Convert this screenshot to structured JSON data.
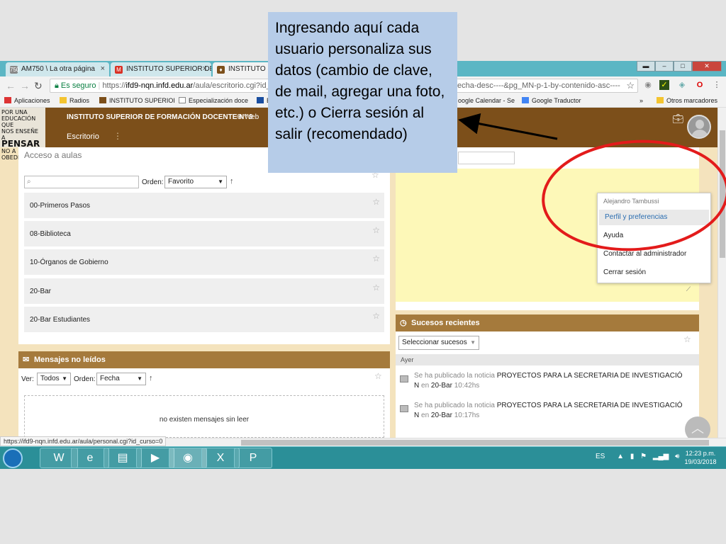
{
  "callout": {
    "text": "Ingresando aquí cada usuario personaliza sus datos (cambio de clave, de mail, agregar una foto, etc.) o Cierra sesión al salir (recomendado)"
  },
  "browser": {
    "tabs": [
      {
        "favicon": "750",
        "title": "AM750 \\ La otra página"
      },
      {
        "favicon": "M",
        "title": "INSTITUTO SUPERIOR DE"
      },
      {
        "favicon": "♦",
        "title": "INSTITUTO SU"
      }
    ],
    "address": {
      "secure_label": "Es seguro",
      "url_scheme": "https://",
      "url_host": "ifd9-nqn.infd.edu.ar",
      "url_path": "/aula/escritorio.cgi?id_c",
      "url_tail": "echa-desc----&pg_MN-p-1-by-contenido-asc----"
    },
    "bookmarks": [
      {
        "label": "Aplicaciones",
        "icon": "apps-grid-icon"
      },
      {
        "label": "Radios",
        "icon": "folder-icon"
      },
      {
        "label": "INSTITUTO SUPERIOI",
        "icon": "moodle-icon"
      },
      {
        "label": "Especialización doce",
        "icon": "page-icon"
      },
      {
        "label": "BP",
        "icon": "bp-icon"
      },
      {
        "label": "oogle Calendar - Se",
        "icon": "calendar-icon"
      },
      {
        "label": "Google Traductor",
        "icon": "translate-icon"
      },
      {
        "label": "»",
        "icon": "more-icon"
      },
      {
        "label": "Otros marcadores",
        "icon": "folder-icon"
      }
    ],
    "status_url": "https://ifd9-nqn.infd.edu.ar/aula/personal.cgi?id_curso=0"
  },
  "site": {
    "logo_lines": [
      "POR UNA",
      "EDUCACIÓN QUE",
      "NOS ENSEÑE A",
      "PENSAR",
      "NO A",
      "OBEDECER"
    ],
    "name": "INSTITUTO SUPERIOR DE FORMACIÓN DOCENTE N° 9",
    "web_label": "Web",
    "nav_escritorio": "Escritorio",
    "nav_more": "⋮"
  },
  "aulas": {
    "title": "Acceso a aulas",
    "order_label": "Orden:",
    "order_value": "Favorito",
    "courses": [
      "00-Primeros Pasos",
      "08-Biblioteca",
      "10-Órganos de Gobierno",
      "20-Bar",
      "20-Bar Estudiantes"
    ]
  },
  "mensajes": {
    "title": "Mensajes no leídos",
    "ver_label": "Ver:",
    "ver_value": "Todos",
    "order_label": "Orden:",
    "order_value": "Fecha",
    "empty_text": "no existen mensajes sin leer"
  },
  "sucesos": {
    "title": "Sucesos recientes",
    "select_value": "Seleccionar sucesos",
    "day": "Ayer",
    "events": [
      {
        "prefix": "Se ha publicado la noticia",
        "title": "PROYECTOS PARA LA SECRETARIA DE INVESTIGACIÓ",
        "title2": "N",
        "en": "en",
        "where": "20-Bar",
        "time": "10:42hs"
      },
      {
        "prefix": "Se ha publicado la noticia",
        "title": "PROYECTOS PARA LA SECRETARIA DE INVESTIGACIÓ",
        "title2": "N",
        "en": "en",
        "where": "20-Bar",
        "time": "10:17hs"
      }
    ]
  },
  "user_menu": {
    "user_name": "Alejandro Tambussi",
    "items": [
      "Perfil y preferencias",
      "Ayuda",
      "Contactar al administrador",
      "Cerrar sesión"
    ]
  },
  "taskbar": {
    "apps": [
      {
        "icon": "word-icon",
        "glyph": "W"
      },
      {
        "icon": "ie-icon",
        "glyph": "e"
      },
      {
        "icon": "explorer-icon",
        "glyph": "▤"
      },
      {
        "icon": "media-player-icon",
        "glyph": "▶"
      },
      {
        "icon": "chrome-icon",
        "glyph": "◉"
      },
      {
        "icon": "excel-icon",
        "glyph": "X"
      },
      {
        "icon": "powerpoint-icon",
        "glyph": "P"
      }
    ],
    "lang": "ES",
    "time": "12:23 p.m.",
    "date": "19/03/2018"
  },
  "colors": {
    "header_brown": "#7c4f1a",
    "block_header": "#a57a3c",
    "callout_bg": "#b6cce8",
    "annotation_red": "#e31b1b",
    "taskbar": "#2b8f98",
    "notepad": "#fdf8b8"
  }
}
